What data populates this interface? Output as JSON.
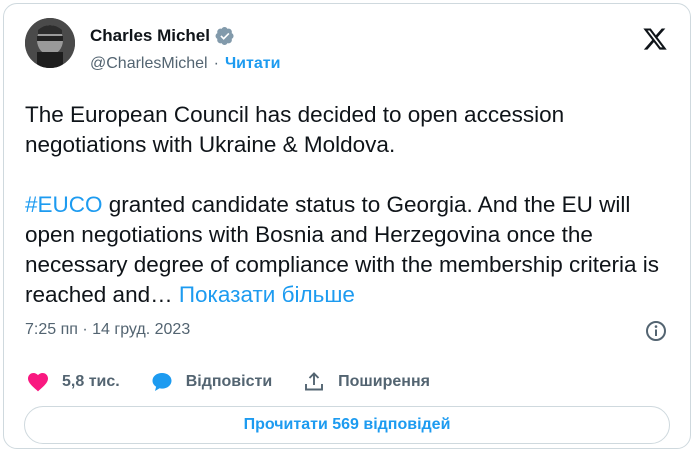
{
  "author": {
    "name": "Charles Michel",
    "handle": "@CharlesMichel",
    "separator": "·",
    "follow_label": "Читати"
  },
  "tweet": {
    "para1": "The European Council has decided to open accession negotiations with Ukraine & Moldova.",
    "hashtag": "#EUCO",
    "para2_rest": " granted candidate status to Georgia. And the EU will open negotiations with Bosnia and Herzegovina once the necessary degree of compliance with the membership criteria  is reached and… ",
    "show_more": "Показати більше"
  },
  "timestamp": "7:25 пп · 14 груд. 2023",
  "actions": {
    "likes": "5,8 тис.",
    "reply": "Відповісти",
    "share": "Поширення"
  },
  "read_replies": "Прочитати 569 відповідей",
  "colors": {
    "accent": "#1d9bf0",
    "like": "#f91880",
    "text": "#0f1419",
    "muted": "#536471",
    "border": "#cfd9de"
  },
  "icons": {
    "verified": "verified-badge-icon",
    "platform": "x-logo-icon",
    "info": "info-icon",
    "like": "heart-icon",
    "reply": "speech-bubble-icon",
    "share": "share-upload-icon"
  }
}
